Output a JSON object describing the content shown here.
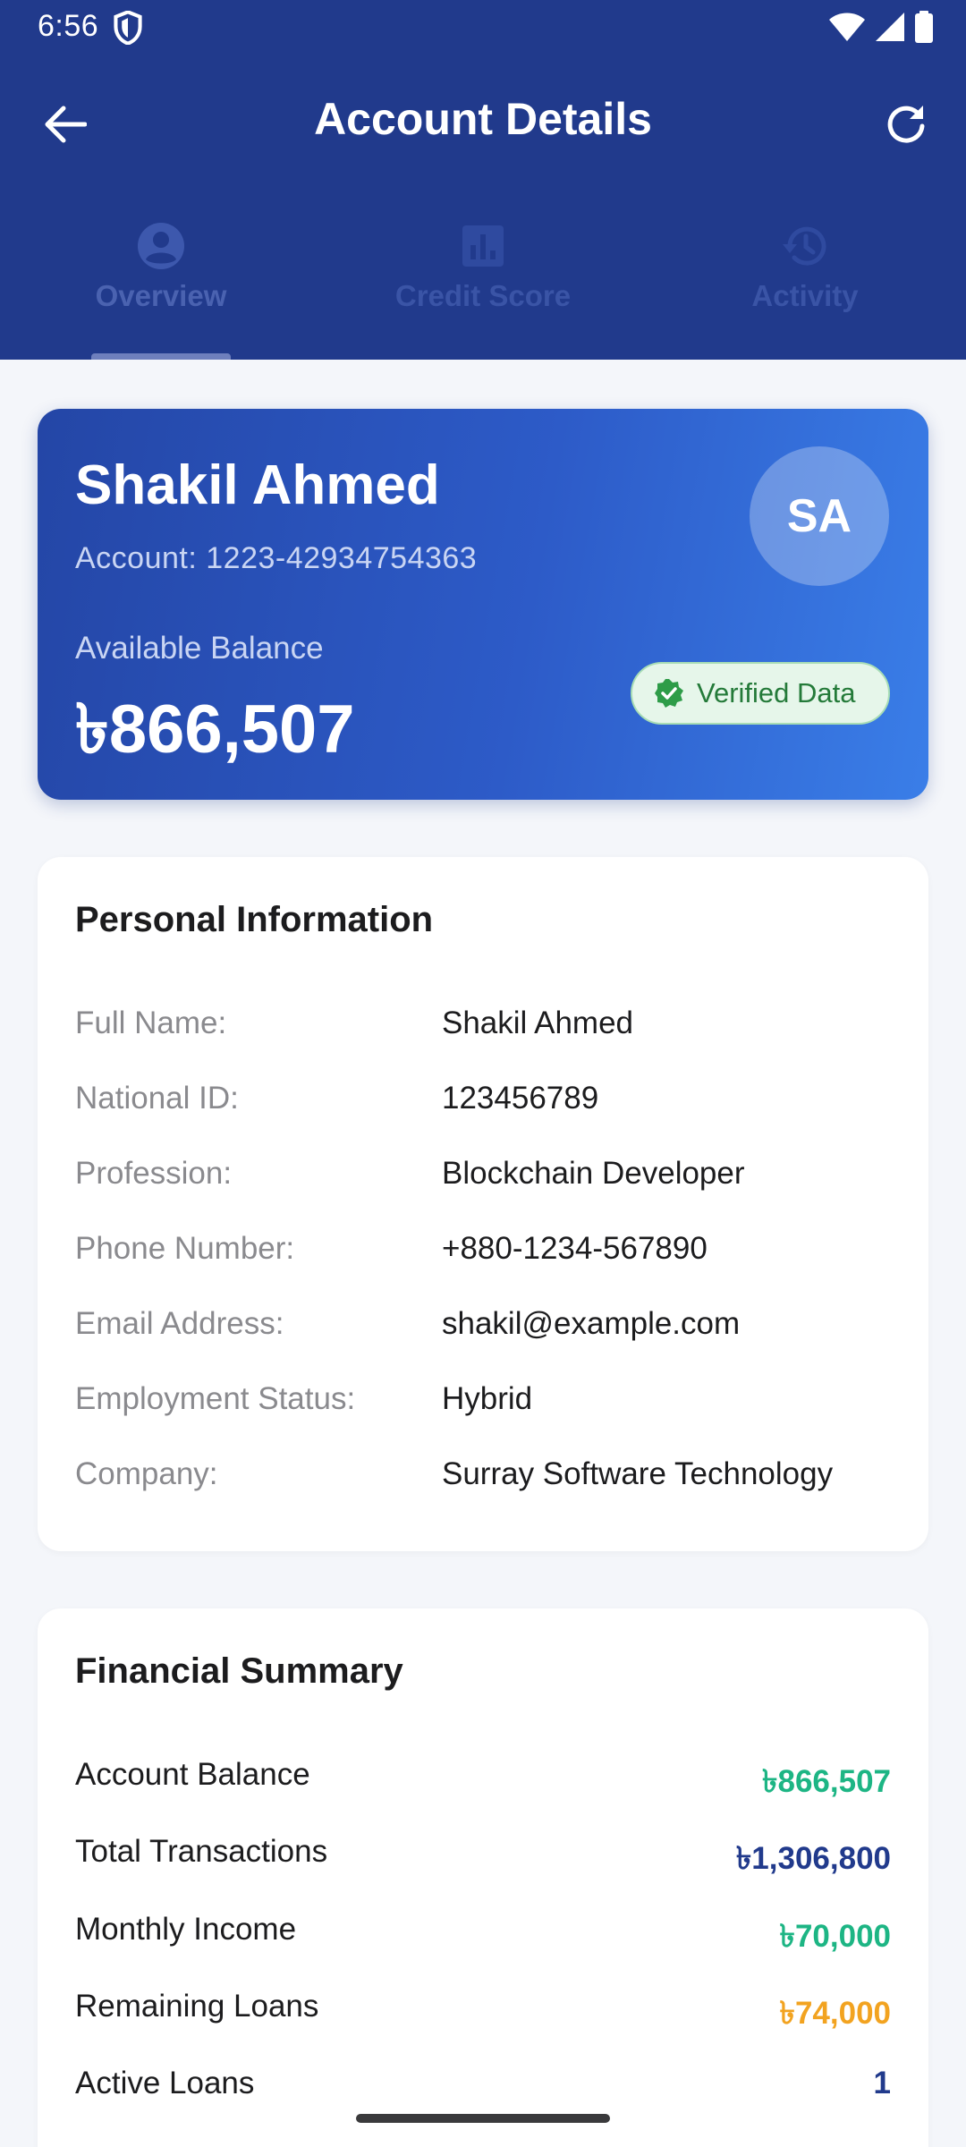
{
  "status_bar": {
    "time": "6:56",
    "icons": [
      "shield-icon",
      "wifi-icon",
      "signal-icon",
      "battery-icon"
    ]
  },
  "header": {
    "title": "Account Details",
    "back_icon": "arrow-back-icon",
    "refresh_icon": "refresh-icon"
  },
  "tabs": [
    {
      "label": "Overview",
      "icon": "account-circle-icon",
      "active": true
    },
    {
      "label": "Credit Score",
      "icon": "bar-chart-icon",
      "active": false
    },
    {
      "label": "Activity",
      "icon": "history-icon",
      "active": false
    }
  ],
  "profile": {
    "name": "Shakil Ahmed",
    "account": "Account: 1223-42934754363",
    "initials": "SA",
    "balance_label": "Available Balance",
    "balance": "৳866,507",
    "verified_label": "Verified Data"
  },
  "personal_info": {
    "title": "Personal Information",
    "rows": [
      {
        "label": "Full Name:",
        "value": "Shakil Ahmed"
      },
      {
        "label": "National ID:",
        "value": "123456789"
      },
      {
        "label": "Profession:",
        "value": "Blockchain Developer"
      },
      {
        "label": "Phone Number:",
        "value": "+880-1234-567890"
      },
      {
        "label": "Email Address:",
        "value": "shakil@example.com"
      },
      {
        "label": "Employment Status:",
        "value": "Hybrid"
      },
      {
        "label": "Company:",
        "value": "Surray Software Technology"
      }
    ]
  },
  "financial_summary": {
    "title": "Financial Summary",
    "rows": [
      {
        "label": "Account Balance",
        "value": "৳866,507",
        "color": "#1db584"
      },
      {
        "label": "Total Transactions",
        "value": "৳1,306,800",
        "color": "#213a8c"
      },
      {
        "label": "Monthly Income",
        "value": "৳70,000",
        "color": "#1db584"
      },
      {
        "label": "Remaining Loans",
        "value": "৳74,000",
        "color": "#f2a320"
      },
      {
        "label": "Active Loans",
        "value": "1",
        "color": "#213a8c"
      }
    ]
  },
  "colors": {
    "primary": "#213a8c",
    "success": "#1db584",
    "warning": "#f2a320",
    "badge_green": "#2e9c48"
  }
}
